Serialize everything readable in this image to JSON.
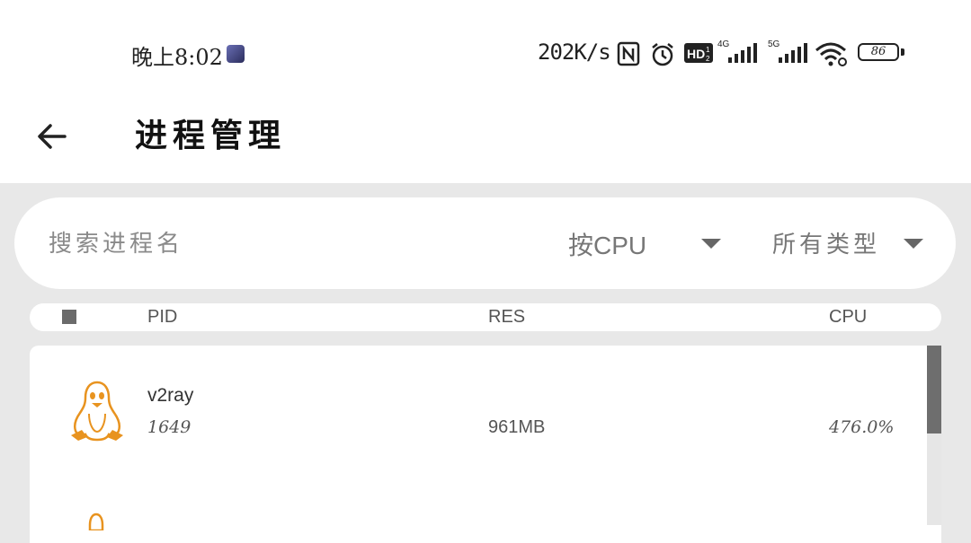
{
  "status_bar": {
    "time": "晚上8:02",
    "net_speed": "202K/s",
    "signal_1_label": "4G",
    "signal_2_label": "5G",
    "battery": "86"
  },
  "app_bar": {
    "title": "进程管理",
    "back_icon": "arrow-left-icon"
  },
  "search": {
    "placeholder": "搜索进程名",
    "sort_dropdown": "按CPU",
    "type_dropdown": "所有类型"
  },
  "table": {
    "columns": [
      "PID",
      "RES",
      "CPU"
    ],
    "rows": [
      {
        "name": "v2ray",
        "pid": "1649",
        "res": "961MB",
        "cpu": "476.0%",
        "icon": "linux-tux-icon"
      }
    ]
  },
  "colors": {
    "accent_icon": "#e8931f",
    "background": "#e8e8e8",
    "card": "#ffffff"
  }
}
